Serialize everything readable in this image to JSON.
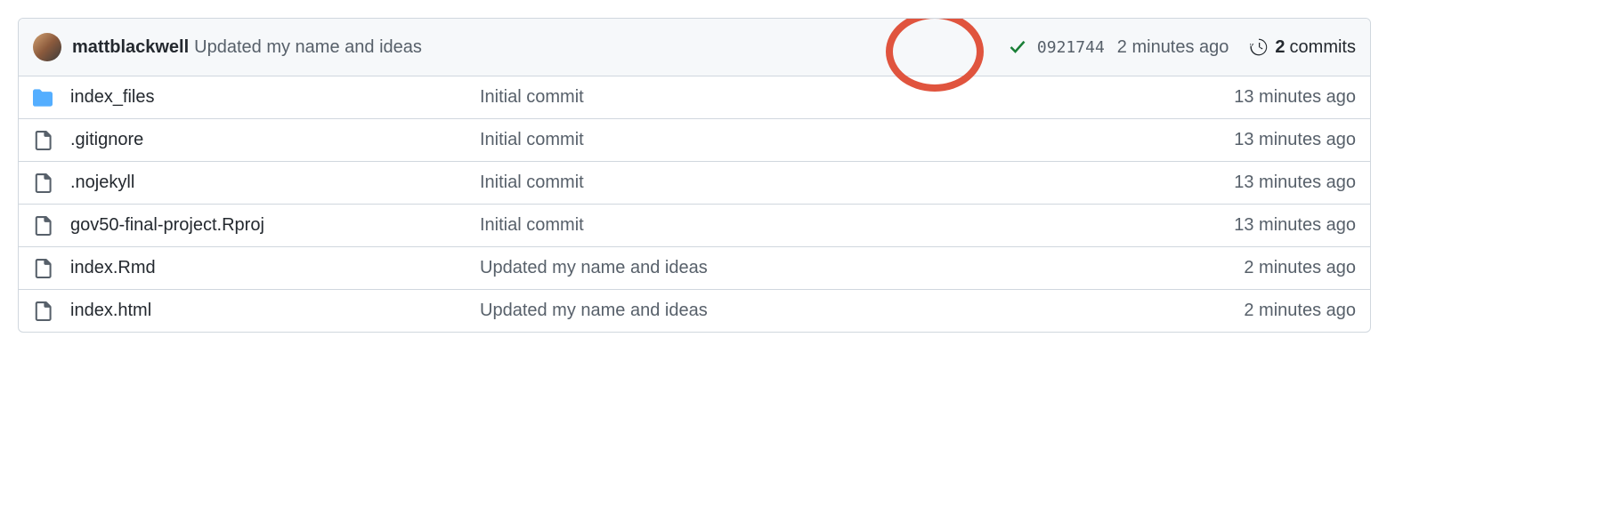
{
  "header": {
    "author": "mattblackwell",
    "message": "Updated my name and ideas",
    "hash": "0921744",
    "time": "2 minutes ago",
    "commits_count": "2",
    "commits_label": "commits"
  },
  "files": [
    {
      "type": "folder",
      "name": "index_files",
      "message": "Initial commit",
      "time": "13 minutes ago"
    },
    {
      "type": "file",
      "name": ".gitignore",
      "message": "Initial commit",
      "time": "13 minutes ago"
    },
    {
      "type": "file",
      "name": ".nojekyll",
      "message": "Initial commit",
      "time": "13 minutes ago"
    },
    {
      "type": "file",
      "name": "gov50-final-project.Rproj",
      "message": "Initial commit",
      "time": "13 minutes ago"
    },
    {
      "type": "file",
      "name": "index.Rmd",
      "message": "Updated my name and ideas",
      "time": "2 minutes ago"
    },
    {
      "type": "file",
      "name": "index.html",
      "message": "Updated my name and ideas",
      "time": "2 minutes ago"
    }
  ]
}
